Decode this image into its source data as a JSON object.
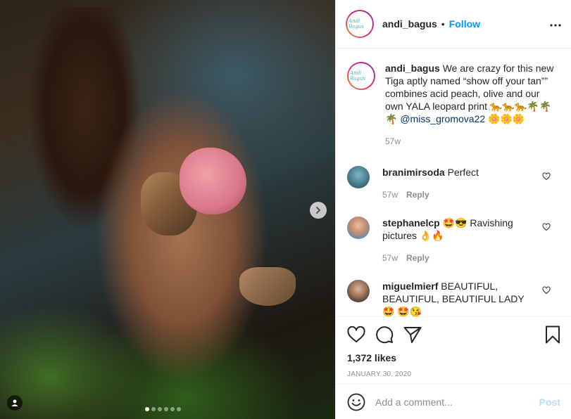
{
  "post": {
    "username": "andi_bagus",
    "follow_label": "Follow",
    "header_separator": "•",
    "avatar_logo_text": "Andi Bagus",
    "carousel": {
      "total_images": 6,
      "active_index": 0
    }
  },
  "caption": {
    "username": "andi_bagus",
    "text": "We are crazy for this new Tiga aptly named “show off your tan”” combines acid peach, olive and our own YALA leopard print 🐆🐆🐆🌴🌴🌴",
    "mention": "@miss_gromova22",
    "trailing": " 🌼🌼🌼",
    "time": "57w"
  },
  "comments": [
    {
      "username": "branimirsoda",
      "text": "Perfect",
      "time": "57w",
      "reply_label": "Reply"
    },
    {
      "username": "stephanelcp",
      "text": "🤩😎 Ravishing pictures 👌🔥",
      "time": "57w",
      "reply_label": "Reply"
    },
    {
      "username": "miguelmierf",
      "text": "BEAUTIFUL, BEAUTIFUL, BEAUTIFUL LADY 🤩 🤩😘",
      "time": "",
      "reply_label": ""
    }
  ],
  "engagement": {
    "likes_label": "1,372 likes",
    "date": "JANUARY 30, 2020"
  },
  "composer": {
    "placeholder": "Add a comment...",
    "post_label": "Post"
  },
  "colors": {
    "follow": "#0095f6",
    "post_disabled": "#b2dffc",
    "muted": "#8e8e8e"
  }
}
